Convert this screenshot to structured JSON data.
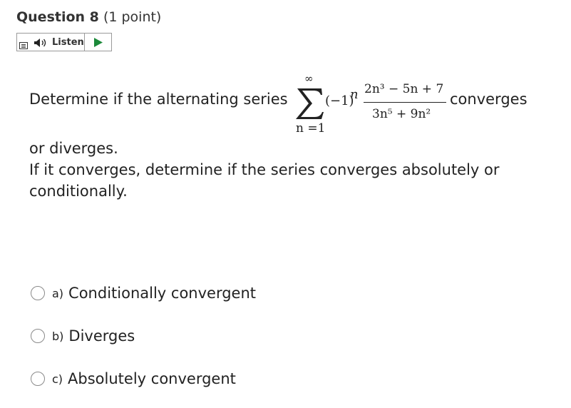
{
  "question": {
    "name": "Question 8",
    "points": "(1 point)"
  },
  "listen": {
    "label": "Listen"
  },
  "stem": {
    "before": "Determine if the alternating series",
    "after": "converges",
    "line2": "or diverges.",
    "line3": "If it converges, determine if the series converges absolutely or",
    "line4": "conditionally."
  },
  "math": {
    "sum_upper": "∞",
    "sum_lower": "n =1",
    "sign_factor": "(−1)",
    "sign_exp": "n",
    "numerator": "2n³ − 5n + 7",
    "denominator": "3n⁵ + 9n²"
  },
  "choices": [
    {
      "letter": "a)",
      "text": "Conditionally convergent"
    },
    {
      "letter": "b)",
      "text": "Diverges"
    },
    {
      "letter": "c)",
      "text": "Absolutely convergent"
    }
  ]
}
